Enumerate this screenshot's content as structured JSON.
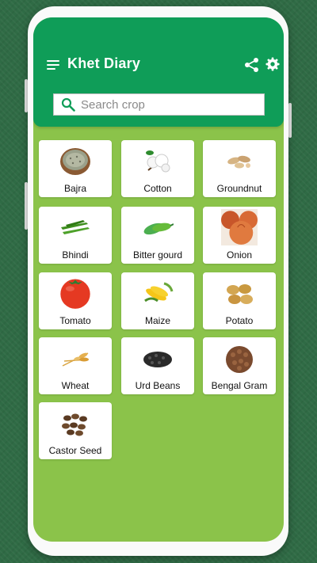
{
  "app": {
    "title": "Khet Diary"
  },
  "search": {
    "placeholder": "Search crop",
    "value": ""
  },
  "icons": {
    "menu": "menu-icon",
    "share": "share-icon",
    "settings": "gear-icon",
    "search": "search-icon"
  },
  "colors": {
    "appbar": "#0f9d58",
    "screen_bg": "#8bc34a",
    "card_bg": "#ffffff",
    "backdrop": "#2f6b45"
  },
  "crops": [
    {
      "label": "Bajra",
      "icon": "bajra-icon"
    },
    {
      "label": "Cotton",
      "icon": "cotton-icon"
    },
    {
      "label": "Groundnut",
      "icon": "groundnut-icon"
    },
    {
      "label": "Bhindi",
      "icon": "bhindi-icon"
    },
    {
      "label": "Bitter gourd",
      "icon": "bitter-gourd-icon"
    },
    {
      "label": "Onion",
      "icon": "onion-icon"
    },
    {
      "label": "Tomato",
      "icon": "tomato-icon"
    },
    {
      "label": "Maize",
      "icon": "maize-icon"
    },
    {
      "label": "Potato",
      "icon": "potato-icon"
    },
    {
      "label": "Wheat",
      "icon": "wheat-icon"
    },
    {
      "label": "Urd Beans",
      "icon": "urd-beans-icon"
    },
    {
      "label": "Bengal Gram",
      "icon": "bengal-gram-icon"
    },
    {
      "label": "Castor Seed",
      "icon": "castor-seed-icon"
    }
  ]
}
